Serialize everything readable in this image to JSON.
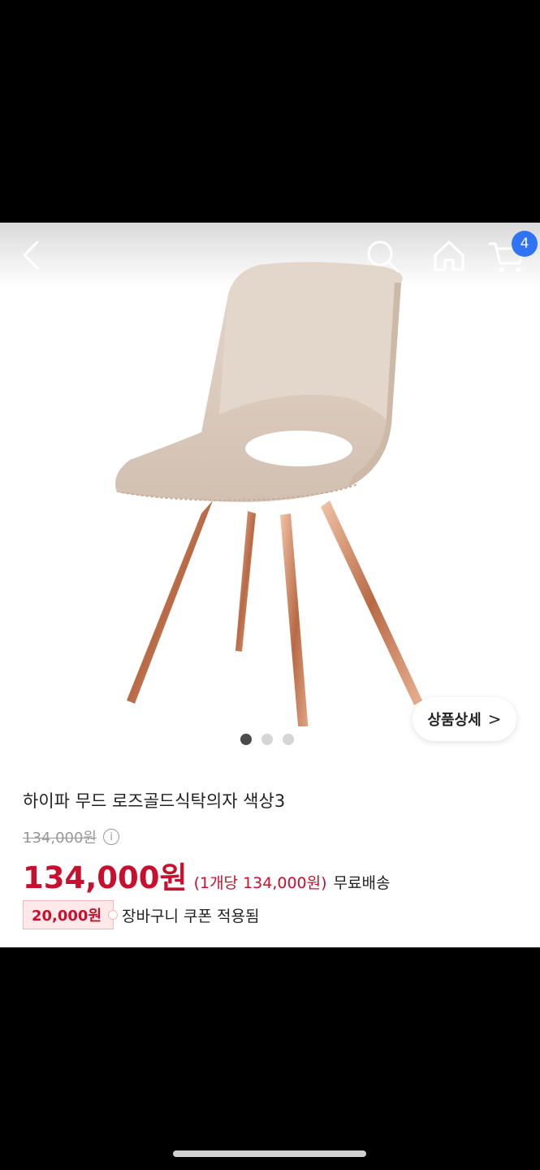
{
  "header": {
    "back_icon": "chevron-left-icon",
    "search_icon": "search-icon",
    "home_icon": "home-icon",
    "cart_icon": "cart-icon",
    "cart_count": "4"
  },
  "gallery": {
    "detail_button_label": "상품상세",
    "detail_chevron": ">",
    "dots_total": 3,
    "active_dot": 1
  },
  "product": {
    "title": "하이파 무드 로즈골드식탁의자 색상3",
    "original_price": "134,000원",
    "price": "134,000원",
    "unit_price": "(1개당 134,000원)",
    "shipping": "무료배송",
    "info_icon": "i"
  },
  "coupon": {
    "amount": "20,000원",
    "text": "장바구니 쿠폰 적용됨"
  },
  "colors": {
    "price_red": "#c8102e",
    "badge_blue": "#2f74f5"
  }
}
